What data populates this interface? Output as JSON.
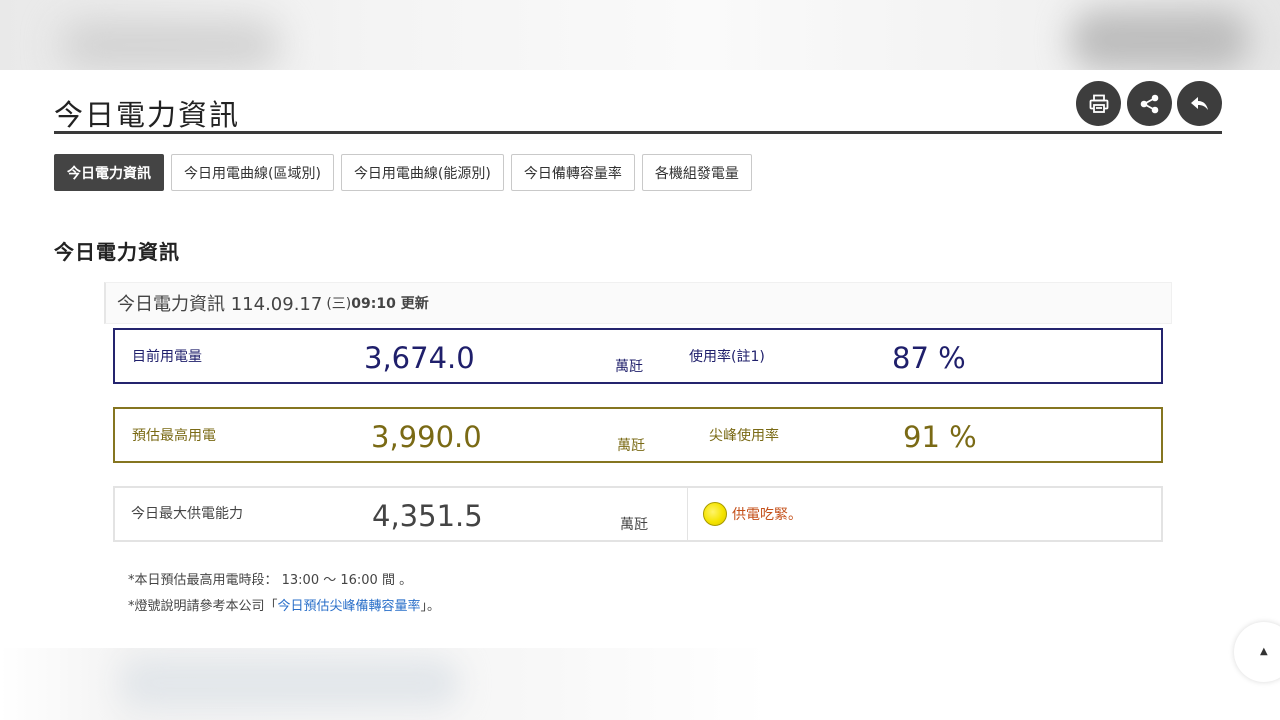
{
  "header": {
    "title": "今日電力資訊",
    "tools": [
      {
        "name": "print",
        "icon": "printer-icon"
      },
      {
        "name": "share",
        "icon": "share-icon"
      },
      {
        "name": "back",
        "icon": "back-arrow-icon"
      }
    ]
  },
  "tabs": [
    {
      "label": "今日電力資訊",
      "active": true
    },
    {
      "label": "今日用電曲線(區域別)",
      "active": false
    },
    {
      "label": "今日用電曲線(能源別)",
      "active": false
    },
    {
      "label": "今日備轉容量率",
      "active": false
    },
    {
      "label": "各機組發電量",
      "active": false
    }
  ],
  "section_title": "今日電力資訊",
  "update": {
    "prefix": "今日電力資訊 114.09.17",
    "weekday": "(三)",
    "time": "09:10 更新"
  },
  "cards": {
    "current": {
      "label": "目前用電量",
      "value": "3,674.0",
      "unit": "萬瓩",
      "rate_label": "使用率(註1)",
      "rate_value": "87 %"
    },
    "peak": {
      "label": "預估最高用電",
      "value": "3,990.0",
      "unit": "萬瓩",
      "rate_label": "尖峰使用率",
      "rate_value": "91 %"
    },
    "capacity": {
      "label": "今日最大供電能力",
      "value": "4,351.5",
      "unit": "萬瓩",
      "status_text": "供電吃緊。",
      "status_color": "#f5e400"
    }
  },
  "notes": {
    "peak_period": "*本日預估最高用電時段： 13:00 ～ 16:00  間  。",
    "light_prefix": "*燈號說明請參考本公司「",
    "light_link": "今日預估尖峰備轉容量率",
    "light_suffix": "」。"
  },
  "colors": {
    "current_border": "#24246e",
    "peak_border": "#857520",
    "link": "#2a6fc9"
  }
}
